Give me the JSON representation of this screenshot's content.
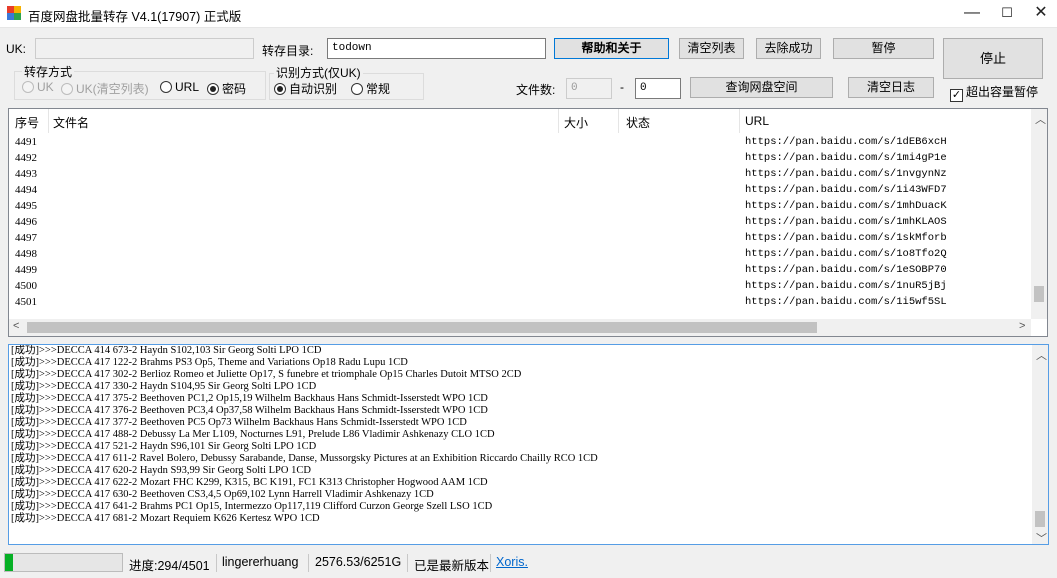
{
  "window": {
    "title": "百度网盘批量转存 V4.1(17907) 正式版",
    "minimize": "—",
    "maximize": "☐",
    "close": "✕"
  },
  "form": {
    "uk_label": "UK:",
    "uk_value": "",
    "dir_label": "转存目录:",
    "dir_value": "todown",
    "help_button": "帮助和关于",
    "clear_list_button": "清空列表",
    "remove_success_button": "去除成功",
    "pause_button": "暂停",
    "stop_button": "停止",
    "mode_group": {
      "title": "转存方式",
      "options": [
        {
          "label": "UK",
          "checked": false,
          "enabled": false
        },
        {
          "label": "UK(清空列表)",
          "checked": false,
          "enabled": false
        },
        {
          "label": "URL",
          "checked": false,
          "enabled": true
        },
        {
          "label": "密码",
          "checked": true,
          "enabled": true
        }
      ]
    },
    "detect_group": {
      "title": "识别方式(仅UK)",
      "options": [
        {
          "label": "自动识别",
          "checked": true
        },
        {
          "label": "常规",
          "checked": false
        }
      ]
    },
    "file_count_label": "文件数:",
    "file_count_from": "0",
    "range_dash": "-",
    "file_count_to": "0",
    "query_space_button": "查询网盘空间",
    "clear_log_button": "清空日志",
    "over_capacity_pause": {
      "label": "超出容量暂停",
      "checked": true
    }
  },
  "list": {
    "columns": [
      "序号",
      "文件名",
      "大小",
      "状态",
      "URL"
    ],
    "rows": [
      {
        "seq": "4491",
        "url": "https://pan.baidu.com/s/1dEB6xcH"
      },
      {
        "seq": "4492",
        "url": "https://pan.baidu.com/s/1mi4gP1e"
      },
      {
        "seq": "4493",
        "url": "https://pan.baidu.com/s/1nvgynNz"
      },
      {
        "seq": "4494",
        "url": "https://pan.baidu.com/s/1i43WFD7"
      },
      {
        "seq": "4495",
        "url": "https://pan.baidu.com/s/1mhDuacK"
      },
      {
        "seq": "4496",
        "url": "https://pan.baidu.com/s/1mhKLAOS"
      },
      {
        "seq": "4497",
        "url": "https://pan.baidu.com/s/1skMforb"
      },
      {
        "seq": "4498",
        "url": "https://pan.baidu.com/s/1o8Tfo2Q"
      },
      {
        "seq": "4499",
        "url": "https://pan.baidu.com/s/1eSOBP70"
      },
      {
        "seq": "4500",
        "url": "https://pan.baidu.com/s/1nuR5jBj"
      },
      {
        "seq": "4501",
        "url": "https://pan.baidu.com/s/1i5wf5SL"
      }
    ]
  },
  "log": {
    "lines": [
      "[成功]>>>DECCA 414 673-2 Haydn S102,103 Sir Georg Solti LPO 1CD",
      "[成功]>>>DECCA 417 122-2 Brahms PS3 Op5, Theme and Variations Op18 Radu Lupu 1CD",
      "[成功]>>>DECCA 417 302-2 Berlioz Romeo et Juliette Op17, S funebre et triomphale Op15 Charles Dutoit MTSO 2CD",
      "[成功]>>>DECCA 417 330-2 Haydn S104,95 Sir Georg Solti LPO 1CD",
      "[成功]>>>DECCA 417 375-2 Beethoven PC1,2 Op15,19 Wilhelm Backhaus Hans Schmidt-Isserstedt WPO 1CD",
      "[成功]>>>DECCA 417 376-2 Beethoven PC3,4 Op37,58 Wilhelm Backhaus Hans Schmidt-Isserstedt WPO 1CD",
      "[成功]>>>DECCA 417 377-2 Beethoven PC5 Op73 Wilhelm Backhaus Hans Schmidt-Isserstedt WPO 1CD",
      "[成功]>>>DECCA 417 488-2 Debussy La Mer L109, Nocturnes L91, Prelude L86 Vladimir Ashkenazy CLO 1CD",
      "[成功]>>>DECCA 417 521-2 Haydn S96,101 Sir Georg Solti LPO 1CD",
      "[成功]>>>DECCA 417 611-2 Ravel Bolero, Debussy Sarabande, Danse, Mussorgsky Pictures at an Exhibition Riccardo Chailly RCO 1CD",
      "[成功]>>>DECCA 417 620-2 Haydn S93,99 Sir Georg Solti LPO 1CD",
      "[成功]>>>DECCA 417 622-2 Mozart FHC K299, K315, BC K191, FC1 K313 Christopher Hogwood AAM 1CD",
      "[成功]>>>DECCA 417 630-2 Beethoven CS3,4,5 Op69,102 Lynn Harrell Vladimir Ashkenazy 1CD",
      "[成功]>>>DECCA 417 641-2 Brahms PC1 Op15, Intermezzo Op117,119 Clifford Curzon George Szell LSO 1CD",
      "[成功]>>>DECCA 417 681-2 Mozart Requiem K626 Kertesz WPO 1CD"
    ]
  },
  "status": {
    "progress_fraction": 0.065,
    "progress_text": "进度:294/4501",
    "user": "lingererhuang",
    "space": "2576.53/6251G",
    "version_status": "已是最新版本",
    "author_link": "Xoris."
  }
}
